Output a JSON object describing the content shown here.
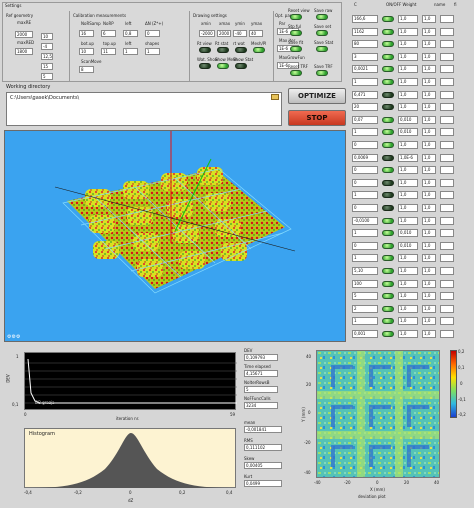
{
  "settings": {
    "title": "Settings",
    "ref_geometry": {
      "title": "Ref geometry",
      "field1_label": "maxRE",
      "field1_value": "2000",
      "field2_label": "maxRED",
      "field2_value": "1800",
      "side_values": [
        "10",
        "-4",
        "12,5",
        "15",
        "5"
      ]
    },
    "calibration": {
      "title": "Calibration measurements",
      "labels": [
        "",
        "NoRSamp",
        "NoRP",
        "left",
        "ΔN (Z*+)"
      ],
      "values": [
        "16",
        "6",
        "0,8",
        "0"
      ],
      "labels2": [
        "",
        "bot.up",
        "top.up",
        "left",
        "shapes"
      ],
      "values2": [
        "10",
        "11",
        "1",
        "1"
      ],
      "scanmove_label": "ScanMove",
      "scanmove_value": "8"
    },
    "drawing": {
      "title": "Drawing settings",
      "labels": [
        "xmin",
        "xmax",
        "ymin",
        "ymax"
      ],
      "values": [
        "-2000",
        "2000",
        "-40",
        "40"
      ],
      "btn_labels": [
        "Rt view",
        "Rt stat",
        "rt wat",
        "Mesh/Pl",
        "Wat. Show",
        "Show Mesh",
        "Show Stat"
      ]
    },
    "opt_par": {
      "title": "Opt. par",
      "labels": [
        "Par",
        "Max iter",
        "MaxGrowFun"
      ],
      "values": [
        "1E-6",
        "1E-6",
        "1E-6"
      ]
    },
    "reset": {
      "labels": [
        "Reset view",
        "Save raw",
        "Stp ful",
        "Save set",
        "Save fit",
        "Save Stat",
        "Reset TRF",
        "Save TRF"
      ]
    }
  },
  "working_dir": {
    "label": "Working directory",
    "value": "C:\\Users\\gasek\\Documents\\"
  },
  "buttons": {
    "optimize": "OPTIMIZE",
    "stop": "STOP"
  },
  "param_table": {
    "headers": [
      "C",
      "ON/OFF Weight",
      "name",
      "fi"
    ],
    "rows": [
      {
        "c": "166,6",
        "on": true,
        "w": "1,0",
        "v": "1,0"
      },
      {
        "c": "1162",
        "on": true,
        "w": "1,0",
        "v": "1,0"
      },
      {
        "c": "80",
        "on": true,
        "w": "1,0",
        "v": "1,0"
      },
      {
        "c": "3",
        "on": true,
        "w": "1,0",
        "v": "1,0"
      },
      {
        "c": "0,0021",
        "on": true,
        "w": "1,0",
        "v": "1,0"
      },
      {
        "c": "1",
        "on": true,
        "w": "1,0",
        "v": "1,0"
      },
      {
        "c": "6,471",
        "on": false,
        "w": "1,0",
        "v": "1,0"
      },
      {
        "c": "20",
        "on": false,
        "w": "1,0",
        "v": "1,0"
      },
      {
        "c": "0,07",
        "on": true,
        "w": "0,010",
        "v": "1,0"
      },
      {
        "c": "1",
        "on": true,
        "w": "0,010",
        "v": "1,0"
      },
      {
        "c": "0",
        "on": true,
        "w": "1,0",
        "v": "1,0"
      },
      {
        "c": "0,0069",
        "on": false,
        "w": "1,0E-6",
        "v": "1,0"
      },
      {
        "c": "0",
        "on": true,
        "w": "1,0",
        "v": "1,0"
      },
      {
        "c": "0",
        "on": false,
        "w": "1,0",
        "v": "1,0"
      },
      {
        "c": "1",
        "on": false,
        "w": "1,0",
        "v": "1,0"
      },
      {
        "c": "0",
        "on": false,
        "w": "1,0",
        "v": "1,0"
      },
      {
        "c": "-0,0100",
        "on": true,
        "w": "1,0",
        "v": "1,0"
      },
      {
        "c": "1",
        "on": true,
        "w": "0,010",
        "v": "1,0"
      },
      {
        "c": "0",
        "on": true,
        "w": "0,010",
        "v": "1,0"
      },
      {
        "c": "1",
        "on": true,
        "w": "1,0",
        "v": "1,0"
      },
      {
        "c": "5,10",
        "on": true,
        "w": "1,0",
        "v": "1,0"
      },
      {
        "c": "100",
        "on": true,
        "w": "1,0",
        "v": "1,0"
      },
      {
        "c": "5",
        "on": true,
        "w": "1,0",
        "v": "1,0"
      },
      {
        "c": "2",
        "on": true,
        "w": "1,0",
        "v": "1,0"
      },
      {
        "c": "1",
        "on": true,
        "w": "1,0",
        "v": "1,0"
      },
      {
        "c": "0,001",
        "on": true,
        "w": "1,0",
        "v": "1,0"
      }
    ]
  },
  "view3d": {
    "bg_color": "#3aa3f0",
    "toolbar_label": "⚙⚙⚙"
  },
  "dev_chart": {
    "y_label": "DEV",
    "x_label": "iteration nr.",
    "y_ticks": [
      "1",
      "0,1"
    ],
    "x_ticks": [
      "0",
      "59"
    ],
    "legend": "DB grazja"
  },
  "stats": {
    "dev_label": "DEV",
    "dev_value": "0,109793",
    "time_label": "Time elapsed",
    "time_value": "4,15671",
    "noiter_label": "NoIterRowsB",
    "noiter_value": "5",
    "nofunc_label": "NoFFuncCalls",
    "nofunc_value": "3234",
    "mean_label": "mean",
    "mean_value": "-0,001841",
    "rms_label": "RMS",
    "rms_value": "0,111102",
    "skew_label": "Skew",
    "skew_value": "0,00405",
    "kurt_label": "Kurt",
    "kurt_value": "0,0499"
  },
  "histogram": {
    "title": "Histogram",
    "x_label": "dZ",
    "x_ticks": [
      "-0,4",
      "-0,2",
      "0",
      "0,2",
      "0,4"
    ],
    "bg_color": "#fdf3d2",
    "fill_color": "#555555"
  },
  "deviation_plot": {
    "title": "deviation plot",
    "x_label": "X (mm)",
    "y_label": "Y (mm)",
    "x_ticks": [
      "-40",
      "-20",
      "0",
      "20",
      "40"
    ],
    "y_ticks": [
      "40",
      "20",
      "0",
      "-20",
      "-40"
    ],
    "colorbar_ticks": [
      "0,2",
      "0,1",
      "0",
      "-0,1",
      "-0,2"
    ]
  }
}
